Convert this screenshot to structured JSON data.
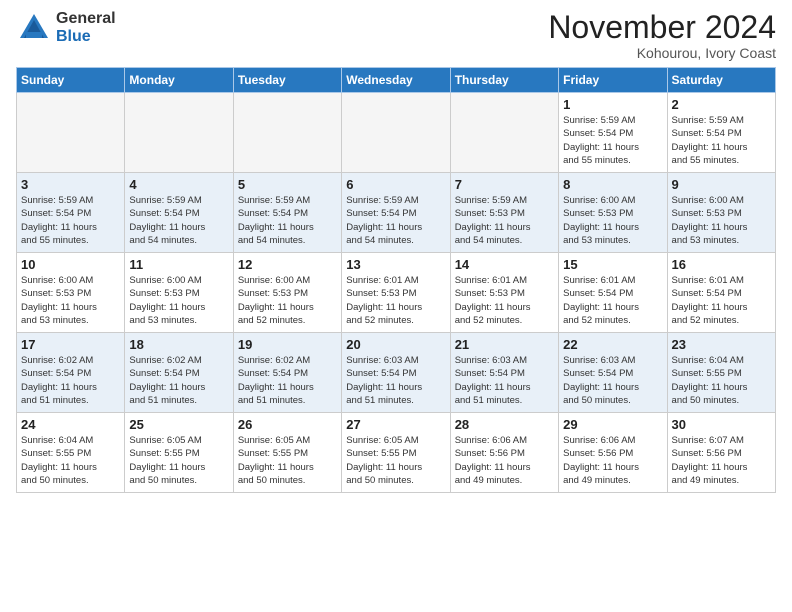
{
  "header": {
    "logo_general": "General",
    "logo_blue": "Blue",
    "month_title": "November 2024",
    "location": "Kohourou, Ivory Coast"
  },
  "weekdays": [
    "Sunday",
    "Monday",
    "Tuesday",
    "Wednesday",
    "Thursday",
    "Friday",
    "Saturday"
  ],
  "weeks": [
    [
      {
        "day": "",
        "info": ""
      },
      {
        "day": "",
        "info": ""
      },
      {
        "day": "",
        "info": ""
      },
      {
        "day": "",
        "info": ""
      },
      {
        "day": "",
        "info": ""
      },
      {
        "day": "1",
        "info": "Sunrise: 5:59 AM\nSunset: 5:54 PM\nDaylight: 11 hours\nand 55 minutes."
      },
      {
        "day": "2",
        "info": "Sunrise: 5:59 AM\nSunset: 5:54 PM\nDaylight: 11 hours\nand 55 minutes."
      }
    ],
    [
      {
        "day": "3",
        "info": "Sunrise: 5:59 AM\nSunset: 5:54 PM\nDaylight: 11 hours\nand 55 minutes."
      },
      {
        "day": "4",
        "info": "Sunrise: 5:59 AM\nSunset: 5:54 PM\nDaylight: 11 hours\nand 54 minutes."
      },
      {
        "day": "5",
        "info": "Sunrise: 5:59 AM\nSunset: 5:54 PM\nDaylight: 11 hours\nand 54 minutes."
      },
      {
        "day": "6",
        "info": "Sunrise: 5:59 AM\nSunset: 5:54 PM\nDaylight: 11 hours\nand 54 minutes."
      },
      {
        "day": "7",
        "info": "Sunrise: 5:59 AM\nSunset: 5:53 PM\nDaylight: 11 hours\nand 54 minutes."
      },
      {
        "day": "8",
        "info": "Sunrise: 6:00 AM\nSunset: 5:53 PM\nDaylight: 11 hours\nand 53 minutes."
      },
      {
        "day": "9",
        "info": "Sunrise: 6:00 AM\nSunset: 5:53 PM\nDaylight: 11 hours\nand 53 minutes."
      }
    ],
    [
      {
        "day": "10",
        "info": "Sunrise: 6:00 AM\nSunset: 5:53 PM\nDaylight: 11 hours\nand 53 minutes."
      },
      {
        "day": "11",
        "info": "Sunrise: 6:00 AM\nSunset: 5:53 PM\nDaylight: 11 hours\nand 53 minutes."
      },
      {
        "day": "12",
        "info": "Sunrise: 6:00 AM\nSunset: 5:53 PM\nDaylight: 11 hours\nand 52 minutes."
      },
      {
        "day": "13",
        "info": "Sunrise: 6:01 AM\nSunset: 5:53 PM\nDaylight: 11 hours\nand 52 minutes."
      },
      {
        "day": "14",
        "info": "Sunrise: 6:01 AM\nSunset: 5:53 PM\nDaylight: 11 hours\nand 52 minutes."
      },
      {
        "day": "15",
        "info": "Sunrise: 6:01 AM\nSunset: 5:54 PM\nDaylight: 11 hours\nand 52 minutes."
      },
      {
        "day": "16",
        "info": "Sunrise: 6:01 AM\nSunset: 5:54 PM\nDaylight: 11 hours\nand 52 minutes."
      }
    ],
    [
      {
        "day": "17",
        "info": "Sunrise: 6:02 AM\nSunset: 5:54 PM\nDaylight: 11 hours\nand 51 minutes."
      },
      {
        "day": "18",
        "info": "Sunrise: 6:02 AM\nSunset: 5:54 PM\nDaylight: 11 hours\nand 51 minutes."
      },
      {
        "day": "19",
        "info": "Sunrise: 6:02 AM\nSunset: 5:54 PM\nDaylight: 11 hours\nand 51 minutes."
      },
      {
        "day": "20",
        "info": "Sunrise: 6:03 AM\nSunset: 5:54 PM\nDaylight: 11 hours\nand 51 minutes."
      },
      {
        "day": "21",
        "info": "Sunrise: 6:03 AM\nSunset: 5:54 PM\nDaylight: 11 hours\nand 51 minutes."
      },
      {
        "day": "22",
        "info": "Sunrise: 6:03 AM\nSunset: 5:54 PM\nDaylight: 11 hours\nand 50 minutes."
      },
      {
        "day": "23",
        "info": "Sunrise: 6:04 AM\nSunset: 5:55 PM\nDaylight: 11 hours\nand 50 minutes."
      }
    ],
    [
      {
        "day": "24",
        "info": "Sunrise: 6:04 AM\nSunset: 5:55 PM\nDaylight: 11 hours\nand 50 minutes."
      },
      {
        "day": "25",
        "info": "Sunrise: 6:05 AM\nSunset: 5:55 PM\nDaylight: 11 hours\nand 50 minutes."
      },
      {
        "day": "26",
        "info": "Sunrise: 6:05 AM\nSunset: 5:55 PM\nDaylight: 11 hours\nand 50 minutes."
      },
      {
        "day": "27",
        "info": "Sunrise: 6:05 AM\nSunset: 5:55 PM\nDaylight: 11 hours\nand 50 minutes."
      },
      {
        "day": "28",
        "info": "Sunrise: 6:06 AM\nSunset: 5:56 PM\nDaylight: 11 hours\nand 49 minutes."
      },
      {
        "day": "29",
        "info": "Sunrise: 6:06 AM\nSunset: 5:56 PM\nDaylight: 11 hours\nand 49 minutes."
      },
      {
        "day": "30",
        "info": "Sunrise: 6:07 AM\nSunset: 5:56 PM\nDaylight: 11 hours\nand 49 minutes."
      }
    ]
  ]
}
